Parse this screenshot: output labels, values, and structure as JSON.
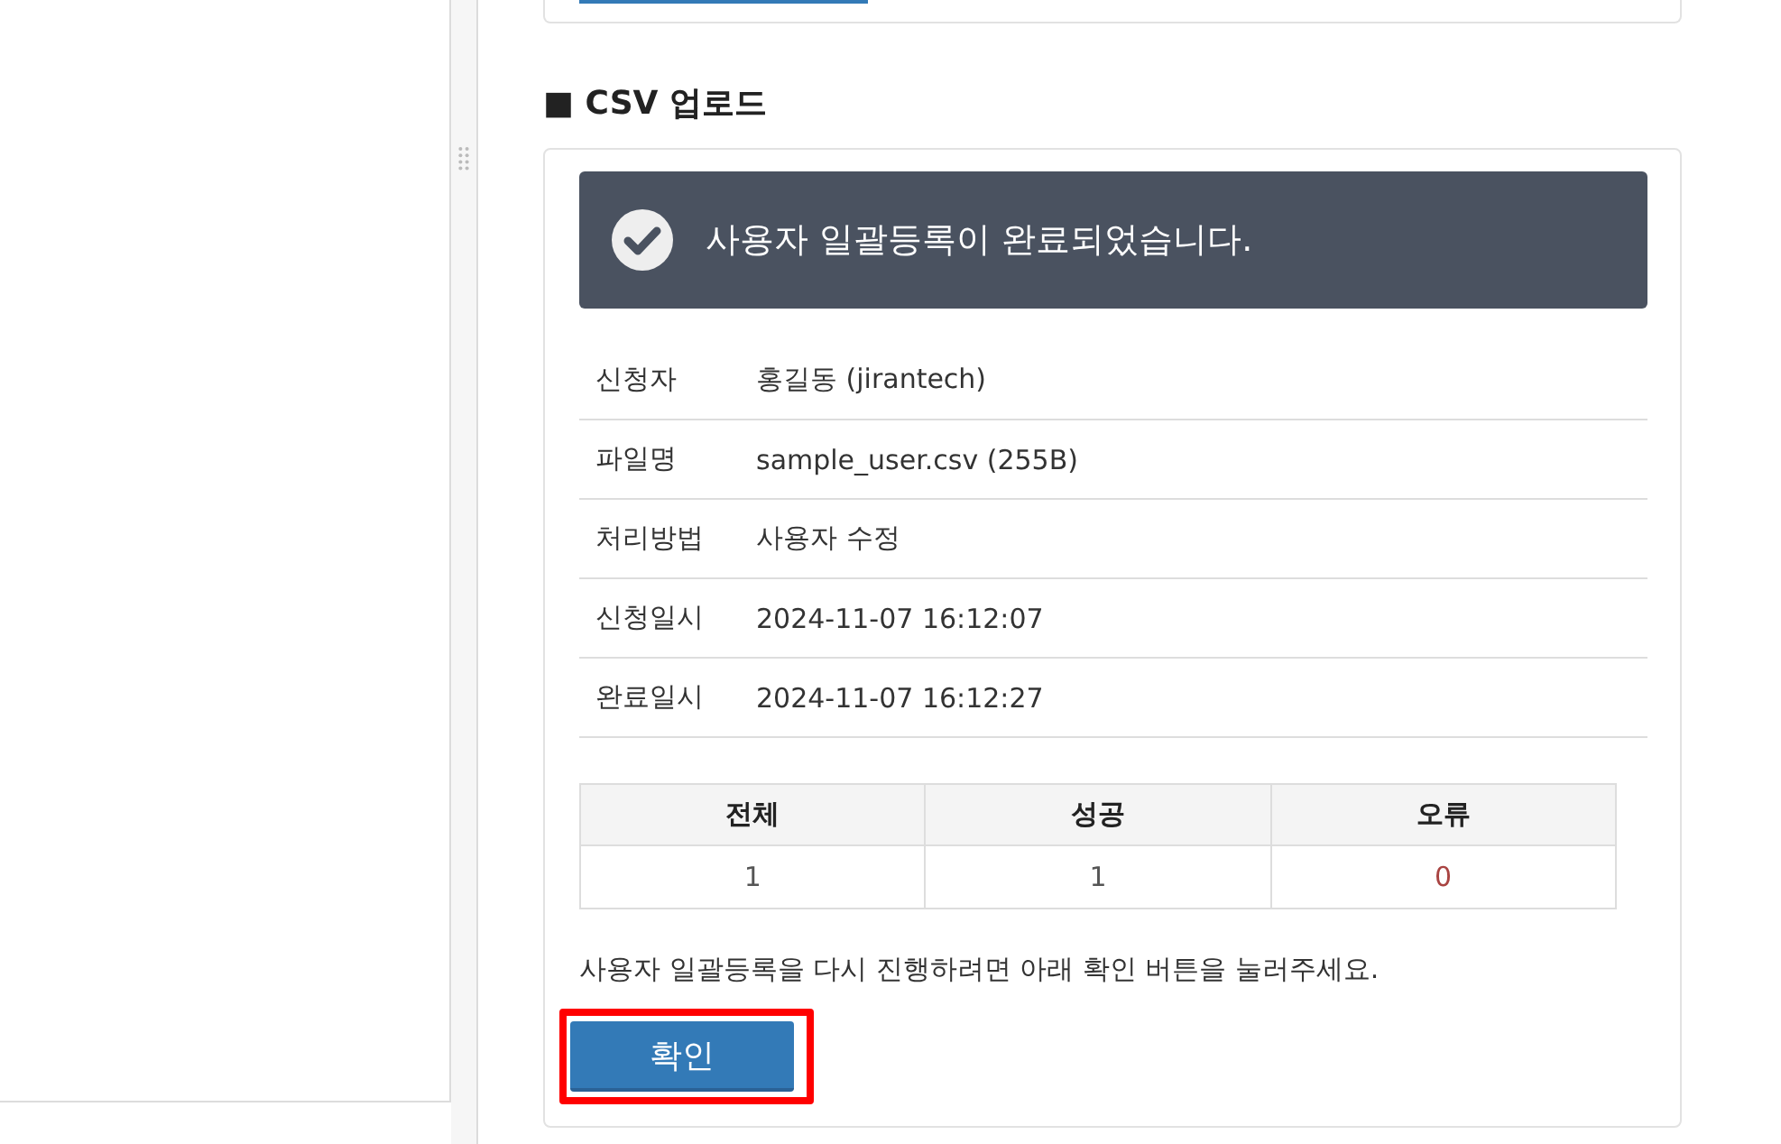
{
  "section_title": "■ CSV 업로드",
  "banner": {
    "message": "사용자 일괄등록이 완료되었습니다."
  },
  "details": [
    {
      "label": "신청자",
      "value": "홍길동 (jirantech)"
    },
    {
      "label": "파일명",
      "value": "sample_user.csv (255B)"
    },
    {
      "label": "처리방법",
      "value": "사용자 수정"
    },
    {
      "label": "신청일시",
      "value": "2024-11-07 16:12:07"
    },
    {
      "label": "완료일시",
      "value": "2024-11-07 16:12:27"
    }
  ],
  "summary": {
    "columns": [
      "전체",
      "성공",
      "오류"
    ],
    "values": [
      {
        "text": "1",
        "kind": "normal"
      },
      {
        "text": "1",
        "kind": "normal"
      },
      {
        "text": "0",
        "kind": "error"
      }
    ]
  },
  "notice": "사용자 일괄등록을 다시 진행하려면 아래 확인 버튼을 눌러주세요.",
  "confirm_button": {
    "label": "확인",
    "highlighted": true
  }
}
